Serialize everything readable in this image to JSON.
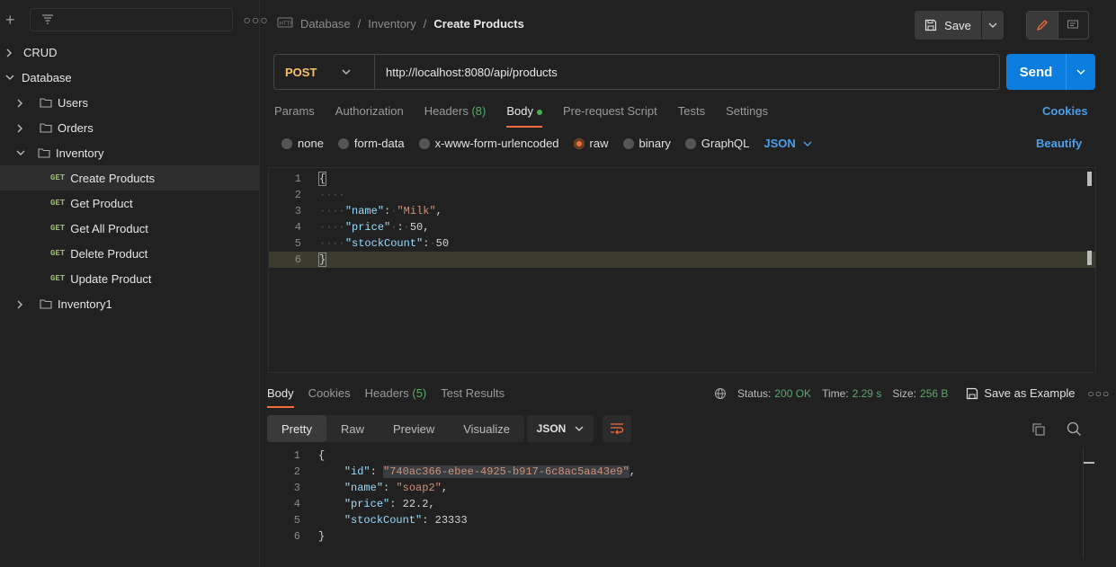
{
  "sidebar": {
    "items": [
      {
        "label": "CRUD",
        "type": "collection"
      },
      {
        "label": "Database",
        "type": "collection"
      },
      {
        "label": "Users",
        "type": "folder"
      },
      {
        "label": "Orders",
        "type": "folder"
      },
      {
        "label": "Inventory",
        "type": "folder"
      },
      {
        "label": "Create Products",
        "method": "GET"
      },
      {
        "label": "Get Product",
        "method": "GET"
      },
      {
        "label": "Get All Product",
        "method": "GET"
      },
      {
        "label": "Delete Product",
        "method": "GET"
      },
      {
        "label": "Update Product",
        "method": "GET"
      },
      {
        "label": "Inventory1",
        "type": "folder"
      }
    ]
  },
  "breadcrumb": {
    "part1": "Database",
    "part2": "Inventory",
    "current": "Create Products",
    "sep": "/"
  },
  "toolbar": {
    "save_label": "Save"
  },
  "request": {
    "method": "POST",
    "url": "http://localhost:8080/api/products",
    "send_label": "Send",
    "tabs": {
      "params": "Params",
      "authorization": "Authorization",
      "headers": "Headers",
      "headers_count": "(8)",
      "body": "Body",
      "prerequest": "Pre-request Script",
      "tests": "Tests",
      "settings": "Settings"
    },
    "cookies_label": "Cookies",
    "body_types": {
      "none": "none",
      "form_data": "form-data",
      "urlencoded": "x-www-form-urlencoded",
      "raw": "raw",
      "binary": "binary",
      "graphql": "GraphQL"
    },
    "format": "JSON",
    "beautify_label": "Beautify",
    "body_lines": {
      "l1": "{",
      "l3_key": "\"name\"",
      "l3_val": "\"Milk\"",
      "l4_key": "\"price\"",
      "l4_val": "50",
      "l5_key": "\"stockCount\"",
      "l5_val": "50",
      "l6": "}"
    }
  },
  "response": {
    "tabs": {
      "body": "Body",
      "cookies": "Cookies",
      "headers": "Headers",
      "headers_count": "(5)",
      "test_results": "Test Results"
    },
    "status_label": "Status:",
    "status_value": "200 OK",
    "time_label": "Time:",
    "time_value": "2.29 s",
    "size_label": "Size:",
    "size_value": "256 B",
    "save_example": "Save as Example",
    "views": {
      "pretty": "Pretty",
      "raw": "Raw",
      "preview": "Preview",
      "visualize": "Visualize"
    },
    "format": "JSON",
    "lines": {
      "l1": "{",
      "id_key": "\"id\"",
      "id_val": "\"740ac366-ebee-4925-b917-6c8ac5aa43e9\"",
      "name_key": "\"name\"",
      "name_val": "\"soap2\"",
      "price_key": "\"price\"",
      "price_val": "22.2",
      "stock_key": "\"stockCount\"",
      "stock_val": "23333",
      "l6": "}"
    }
  },
  "colors": {
    "accent": "#f26b3a",
    "send": "#0b7dde",
    "link": "#4b9fea",
    "method_post": "#f4c06a",
    "method_get": "#9bb97a",
    "status_ok": "#5aa86b"
  }
}
